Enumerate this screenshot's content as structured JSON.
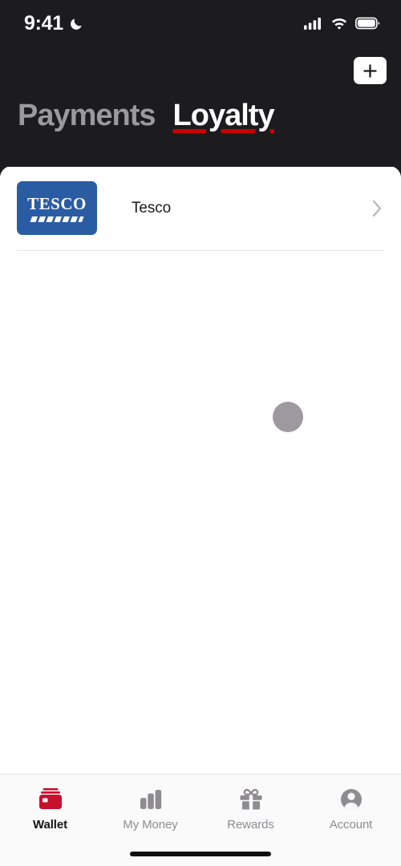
{
  "status_bar": {
    "time": "9:41",
    "dnd_icon": "moon-icon",
    "signal_icon": "cellular-signal-icon",
    "wifi_icon": "wifi-icon",
    "battery_icon": "battery-icon"
  },
  "header": {
    "add_button_icon": "plus-icon",
    "add_button_label": "+",
    "tabs": [
      {
        "label": "Payments",
        "active": false
      },
      {
        "label": "Loyalty",
        "active": true
      }
    ],
    "active_underline_color": "#cc0000",
    "background_color": "#1c1c1e"
  },
  "content": {
    "loyalty_cards": [
      {
        "name": "Tesco",
        "logo_text": "TESCO",
        "logo_bg_color": "#2a5ca4",
        "chevron_icon": "chevron-right-icon"
      }
    ],
    "loading_indicator": {
      "icon": "loading-spinner",
      "color": "#9c9a9e"
    }
  },
  "tab_bar": {
    "items": [
      {
        "label": "Wallet",
        "icon": "wallet-icon",
        "active": true
      },
      {
        "label": "My Money",
        "icon": "bar-chart-icon",
        "active": false
      },
      {
        "label": "Rewards",
        "icon": "gift-icon",
        "active": false
      },
      {
        "label": "Account",
        "icon": "account-avatar-icon",
        "active": false
      }
    ],
    "active_color": "#c8102e",
    "inactive_color": "#8e8c90"
  },
  "home_indicator": "home-indicator"
}
